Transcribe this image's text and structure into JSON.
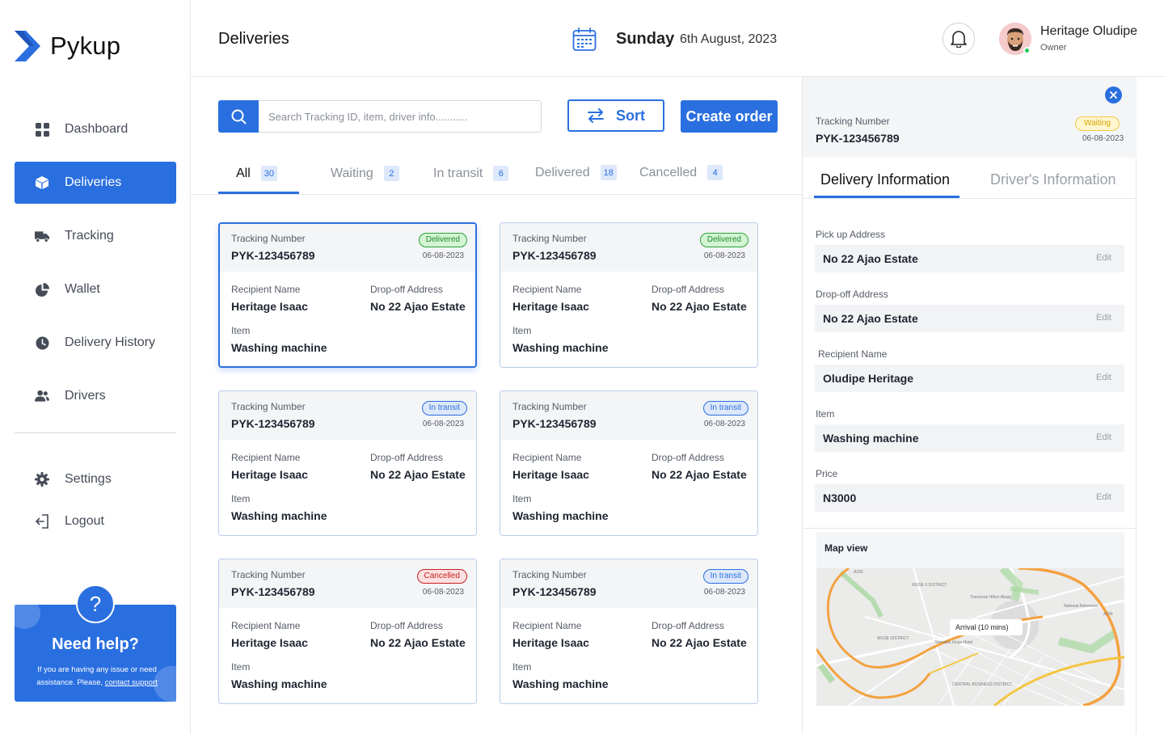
{
  "app": {
    "name": "Pykup",
    "brand_color": "#2a6fe0"
  },
  "sidebar": {
    "items": [
      {
        "label": "Dashboard",
        "icon": "grid-icon",
        "active": false
      },
      {
        "label": "Deliveries",
        "icon": "box-icon",
        "active": true
      },
      {
        "label": "Tracking",
        "icon": "truck-icon",
        "active": false
      },
      {
        "label": "Wallet",
        "icon": "pie-chart-icon",
        "active": false
      },
      {
        "label": "Delivery History",
        "icon": "clock-icon",
        "active": false
      },
      {
        "label": "Drivers",
        "icon": "users-icon",
        "active": false
      }
    ],
    "bottom_items": [
      {
        "label": "Settings",
        "icon": "gear-icon"
      },
      {
        "label": "Logout",
        "icon": "logout-icon"
      }
    ],
    "help": {
      "title": "Need help?",
      "text": "If you are having any issue or need assistance. Please,",
      "link": "contact support"
    }
  },
  "header": {
    "title": "Deliveries",
    "day": "Sunday",
    "date": "6th August, 2023",
    "user": {
      "name": "Heritage Oludipe",
      "role": "Owner"
    }
  },
  "toolbar": {
    "search_placeholder": "Search Tracking ID, item, driver info...........",
    "sort_label": "Sort",
    "create_label": "Create order"
  },
  "tabs": [
    {
      "label": "All",
      "count": "30",
      "active": true
    },
    {
      "label": "Waiting",
      "count": "2",
      "active": false
    },
    {
      "label": "In transit",
      "count": "6",
      "active": false
    },
    {
      "label": "Delivered",
      "count": "18",
      "active": false
    },
    {
      "label": "Cancelled",
      "count": "4",
      "active": false
    }
  ],
  "card_labels": {
    "tracking": "Tracking Number",
    "recipient": "Recipient Name",
    "dropoff": "Drop-off Address",
    "item": "Item"
  },
  "cards": [
    {
      "tracking": "PYK-123456789",
      "status": "Delivered",
      "status_kind": "delivered",
      "date": "06-08-2023",
      "recipient": "Heritage Isaac",
      "dropoff": "No 22 Ajao Estate",
      "item": "Washing machine"
    },
    {
      "tracking": "PYK-123456789",
      "status": "Delivered",
      "status_kind": "delivered",
      "date": "06-08-2023",
      "recipient": "Heritage Isaac",
      "dropoff": "No 22 Ajao Estate",
      "item": "Washing machine"
    },
    {
      "tracking": "PYK-123456789",
      "status": "In transit",
      "status_kind": "transit",
      "date": "06-08-2023",
      "recipient": "Heritage Isaac",
      "dropoff": "No 22 Ajao Estate",
      "item": "Washing machine"
    },
    {
      "tracking": "PYK-123456789",
      "status": "In transit",
      "status_kind": "transit",
      "date": "06-08-2023",
      "recipient": "Heritage Isaac",
      "dropoff": "No 22 Ajao Estate",
      "item": "Washing machine"
    },
    {
      "tracking": "PYK-123456789",
      "status": "Cancelled",
      "status_kind": "cancelled",
      "date": "06-08-2023",
      "recipient": "Heritage Isaac",
      "dropoff": "No 22 Ajao Estate",
      "item": "Washing machine"
    },
    {
      "tracking": "PYK-123456789",
      "status": "In transit",
      "status_kind": "transit",
      "date": "06-08-2023",
      "recipient": "Heritage Isaac",
      "dropoff": "No 22 Ajao Estate",
      "item": "Washing machine"
    }
  ],
  "details": {
    "tracking_label": "Tracking Number",
    "tracking": "PYK-123456789",
    "status": "Waiting",
    "date": "06-08-2023",
    "tabs": [
      "Delivery Information",
      "Driver's Information"
    ],
    "edit_label": "Edit",
    "fields": [
      {
        "label": "Pick up Address",
        "value": "No 22 Ajao Estate"
      },
      {
        "label": "Drop-off Address",
        "value": "No 22 Ajao Estate"
      },
      {
        "label": "Recipient Name",
        "value": "Oludipe Heritage"
      },
      {
        "label": "Item",
        "value": "Washing machine"
      },
      {
        "label": "Price",
        "value": "N3000"
      }
    ],
    "map": {
      "title": "Map view",
      "arrival": "Arrival (10 mins)",
      "labels": [
        "Transcorp Hilton Abuja",
        "WUSE II DISTRICT",
        "National Arboretum",
        "WUSE DISTRICT",
        "Sheraton Abuja Hotel",
        "CENTRAL BUSINESS DISTRICT",
        "A234",
        "A236"
      ]
    }
  }
}
